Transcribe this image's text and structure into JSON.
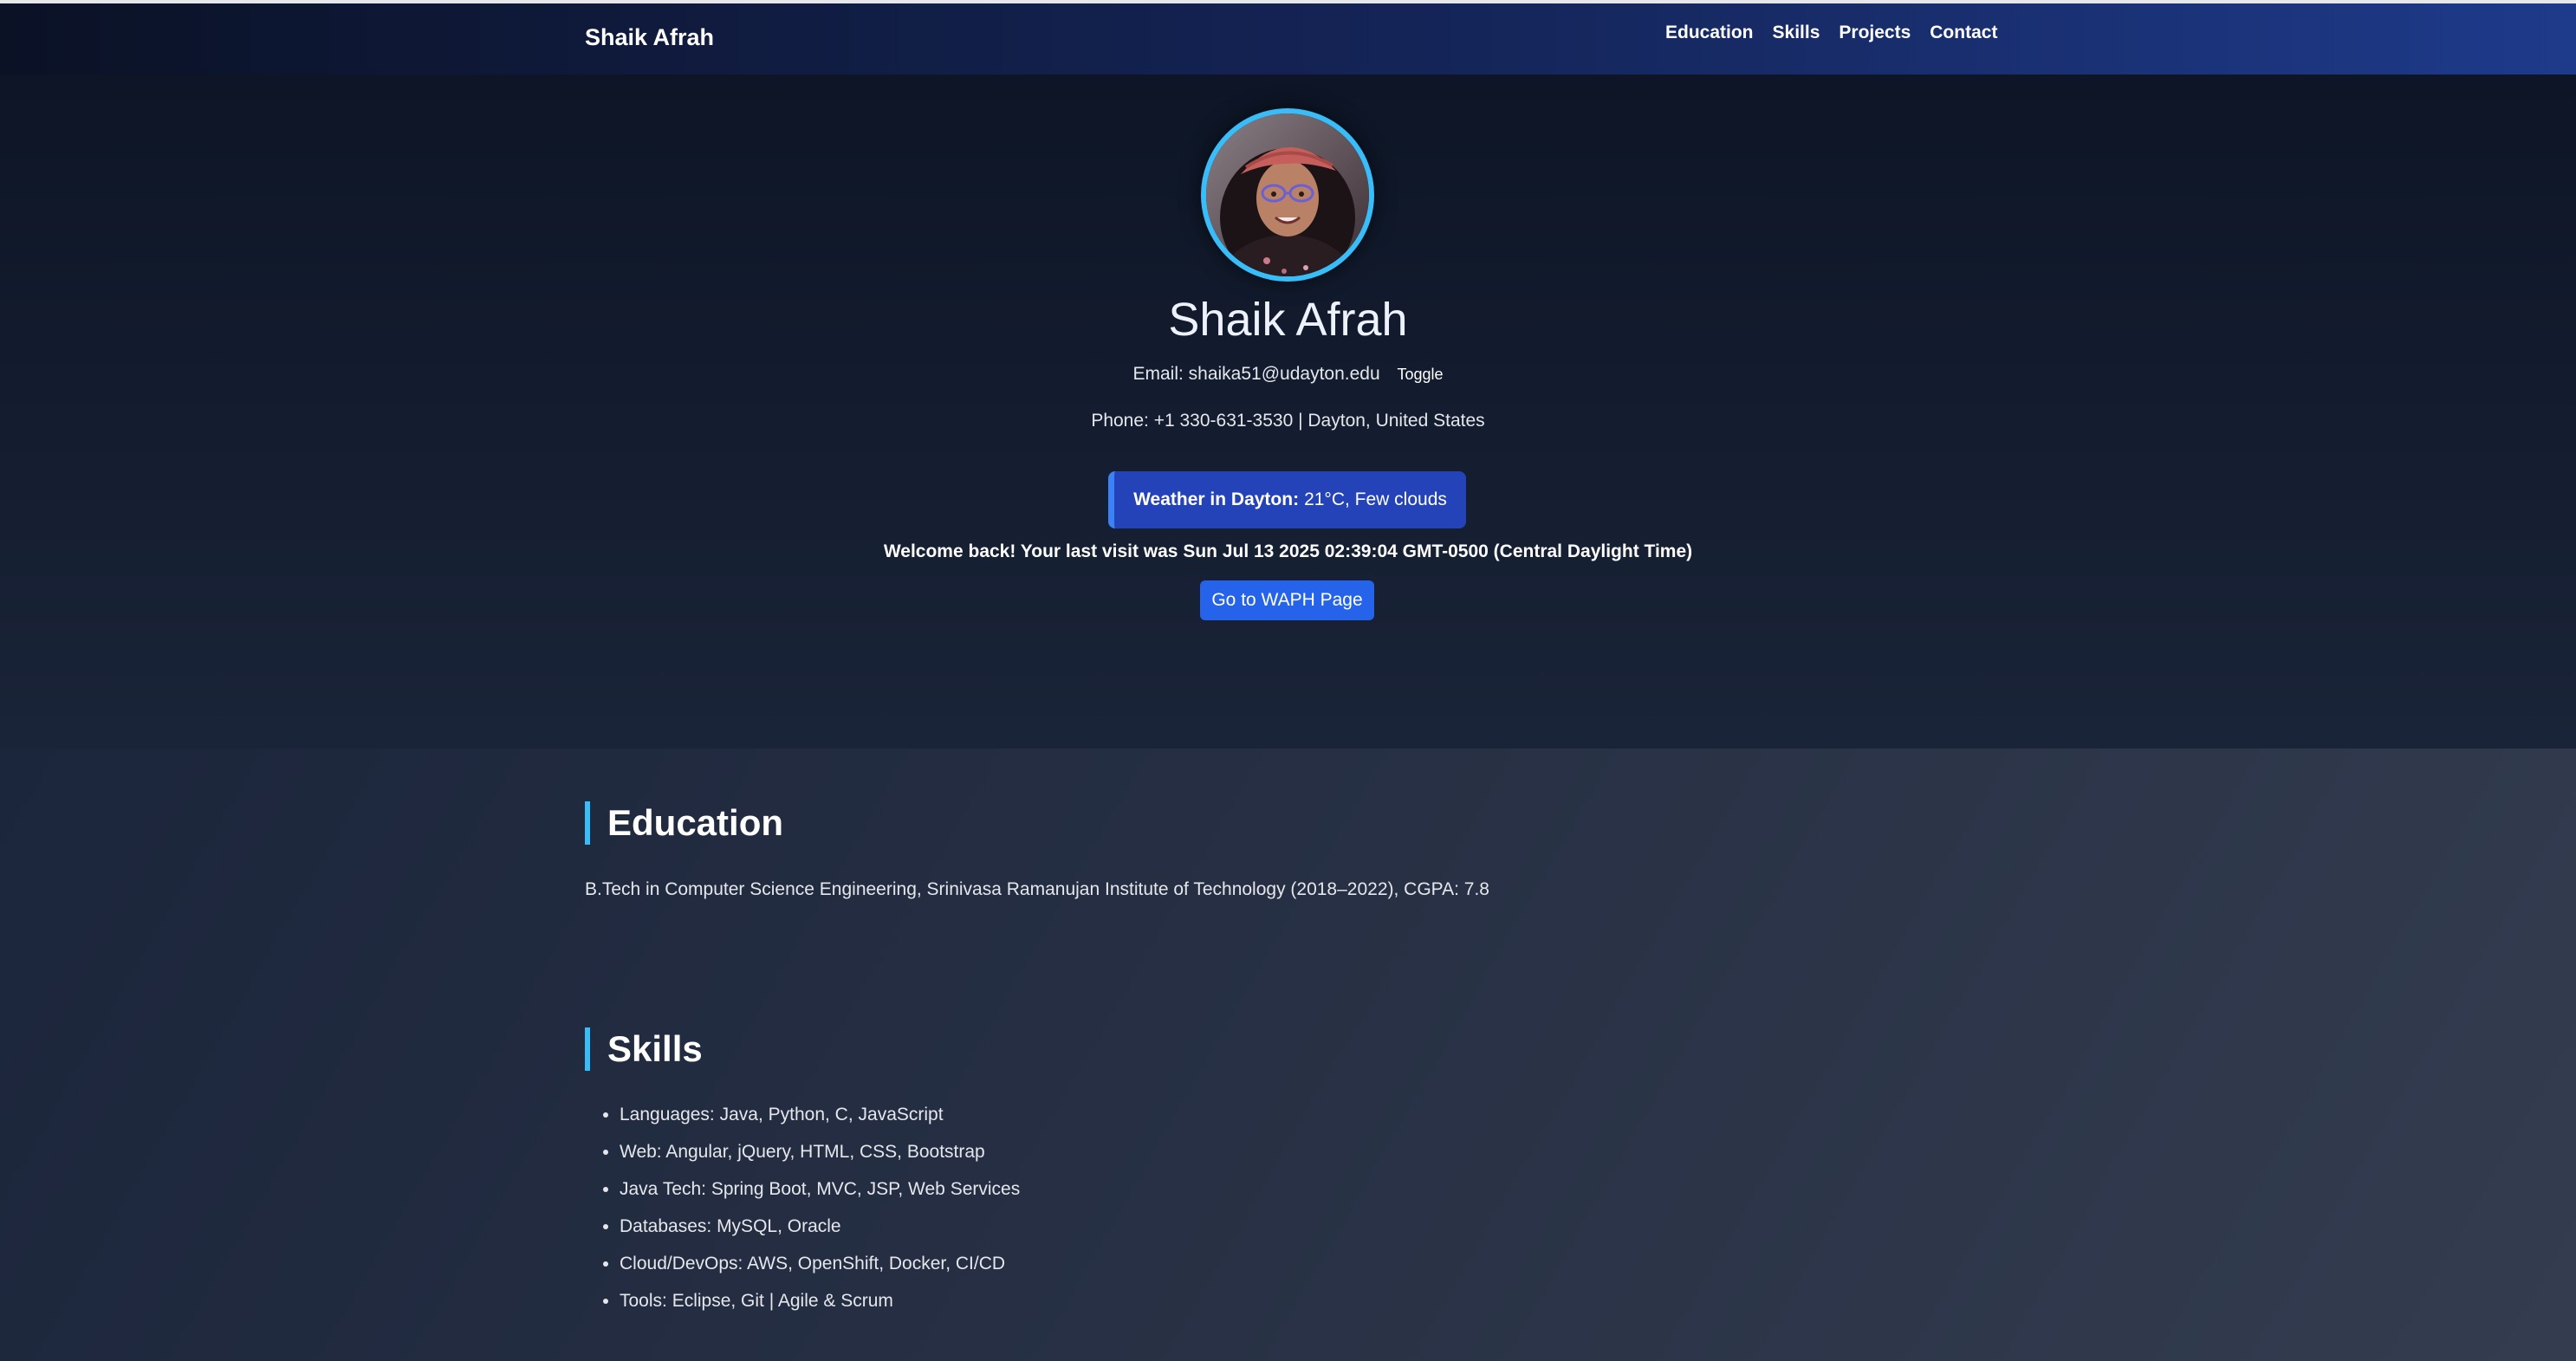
{
  "navbar": {
    "brand": "Shaik Afrah",
    "links": [
      "Education",
      "Skills",
      "Projects",
      "Contact"
    ]
  },
  "hero": {
    "name": "Shaik Afrah",
    "email_text": "Email: shaika51@udayton.edu",
    "toggle_label": "Toggle",
    "phone_text": "Phone: +1 330-631-3530 | Dayton, United States",
    "weather_label": "Weather in Dayton:",
    "weather_value": "21°C, Few clouds",
    "welcome_text": "Welcome back! Your last visit was Sun Jul 13 2025 02:39:04 GMT-0500 (Central Daylight Time)",
    "waph_button": "Go to WAPH Page"
  },
  "education": {
    "title": "Education",
    "text": "B.Tech in Computer Science Engineering, Srinivasa Ramanujan Institute of Technology (2018–2022), CGPA: 7.8"
  },
  "skills": {
    "title": "Skills",
    "items": [
      "Languages: Java, Python, C, JavaScript",
      "Web: Angular, jQuery, HTML, CSS, Bootstrap",
      "Java Tech: Spring Boot, MVC, JSP, Web Services",
      "Databases: MySQL, Oracle",
      "Cloud/DevOps: AWS, OpenShift, Docker, CI/CD",
      "Tools: Eclipse, Git | Agile & Scrum"
    ]
  },
  "colors": {
    "accent": "#38bdf8",
    "button": "#2563eb",
    "weather_bg": "#2543b8"
  }
}
